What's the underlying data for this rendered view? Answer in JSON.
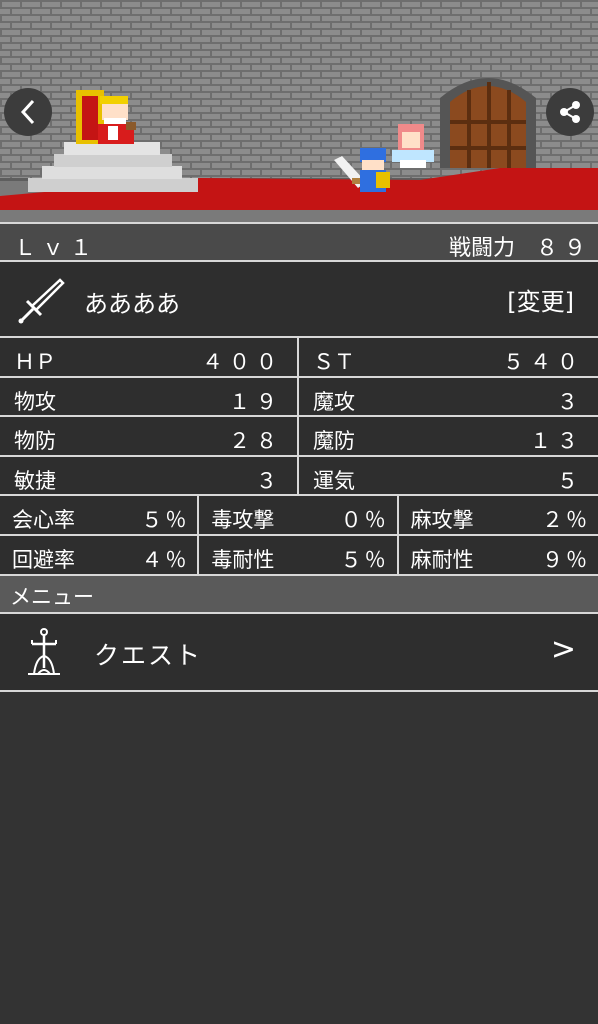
{
  "header": {
    "back_label": "<",
    "share_icon": "share-icon"
  },
  "status": {
    "level": "Ｌｖ１",
    "power_label": "戦闘力",
    "power_value": "８９"
  },
  "weapon": {
    "icon": "sword-icon",
    "name": "ああああ",
    "change_label": "[変更]"
  },
  "stats": [
    [
      {
        "label": "ＨＰ",
        "value": "４００"
      },
      {
        "label": "ＳＴ",
        "value": "５４０"
      }
    ],
    [
      {
        "label": "物攻",
        "value": "１９"
      },
      {
        "label": "魔攻",
        "value": "３"
      }
    ],
    [
      {
        "label": "物防",
        "value": "２８"
      },
      {
        "label": "魔防",
        "value": "１３"
      }
    ],
    [
      {
        "label": "敏捷",
        "value": "３"
      },
      {
        "label": "運気",
        "value": "５"
      }
    ]
  ],
  "sub_stats": [
    [
      {
        "label": "会心率",
        "value": "５％"
      },
      {
        "label": "毒攻撃",
        "value": "０％"
      },
      {
        "label": "麻攻撃",
        "value": "２％"
      }
    ],
    [
      {
        "label": "回避率",
        "value": "４％"
      },
      {
        "label": "毒耐性",
        "value": "５％"
      },
      {
        "label": "麻耐性",
        "value": "９％"
      }
    ]
  ],
  "menu": {
    "title": "メニュー",
    "items": [
      {
        "label": "クエスト",
        "icon": "tower-icon",
        "arrow": ">"
      }
    ]
  },
  "colors": {
    "background": "#333333",
    "scene_wall": "#8a8a8a",
    "carpet": "#c41414",
    "bar": "#4a4a4a",
    "border": "#d8d8d8"
  }
}
